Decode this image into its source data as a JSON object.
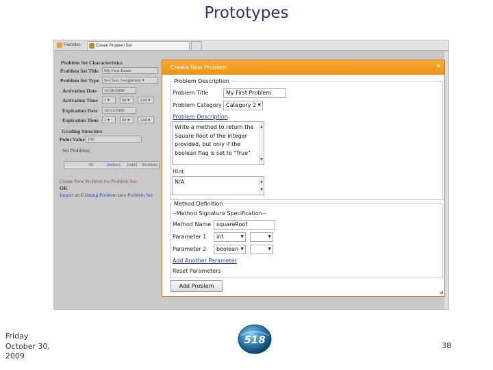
{
  "slide": {
    "title": "Prototypes",
    "date_lines": [
      "Friday",
      "October 30,",
      "2009"
    ],
    "page_number": "38",
    "logo_text": "518"
  },
  "browser": {
    "tabs": [
      {
        "label": "Favorites",
        "icon": "star-folder-icon"
      },
      {
        "label": "Create Problem Set",
        "icon": "page-icon"
      }
    ]
  },
  "background_form": {
    "heading": "Problem Set Characteristics",
    "fields": [
      {
        "label": "Problem Set Title",
        "value": "My First Exam"
      },
      {
        "label": "Problem Set Type",
        "value": "In-Class Assignment"
      },
      {
        "label": "Activation Date",
        "value": "10/28/2009"
      },
      {
        "label": "Activation Time",
        "hour": "1",
        "minute": "00",
        "ampm": "AM"
      },
      {
        "label": "Expiration Date",
        "value": "10/31/2009"
      },
      {
        "label": "Expiration Time",
        "hour": "1",
        "minute": "00",
        "ampm": "AM"
      }
    ],
    "grading_heading": "Grading Structure",
    "point_value_label": "Point Value",
    "point_value": "100",
    "set_problems_label": "Set Problems",
    "problem_row": {
      "points": "50",
      "delete": "[delete]",
      "edit": "[edit]",
      "name": "Problem"
    },
    "link_create": "Create New Problem for Problem Set",
    "ok_label": "OK",
    "link_import": "Import an Existing Problem into Problem Set"
  },
  "modal": {
    "title": "Create New Problem",
    "close": "×",
    "problem_description": {
      "legend": "Problem Description",
      "title_label": "Problem Title",
      "title_value": "My First Problem",
      "category_label": "Problem Category",
      "category_value": "Category 2",
      "description_label": "Problem Description",
      "description_lines": [
        "Write a method to return the",
        "Square Root of the integer",
        "provided, but only if the",
        "boolean flag is set to \"True\""
      ],
      "hint_label": "Hint",
      "hint_value": "N/A"
    },
    "method_definition": {
      "legend": "Method Definition",
      "signature_heading": "--Method Signature Specification--",
      "method_name_label": "Method Name",
      "method_name_value": "squareRoot",
      "params": [
        {
          "label": "Parameter 1",
          "type": "int",
          "name": ""
        },
        {
          "label": "Parameter 2",
          "type": "boolean",
          "name": ""
        }
      ],
      "add_param_link": "Add Another Parameter",
      "reset_params": "Reset Parameters"
    },
    "add_button": "Add Problem"
  },
  "colors": {
    "modal_header": "#ee9210",
    "title_text": "#3b2a7a",
    "link": "#1f3d9a"
  }
}
